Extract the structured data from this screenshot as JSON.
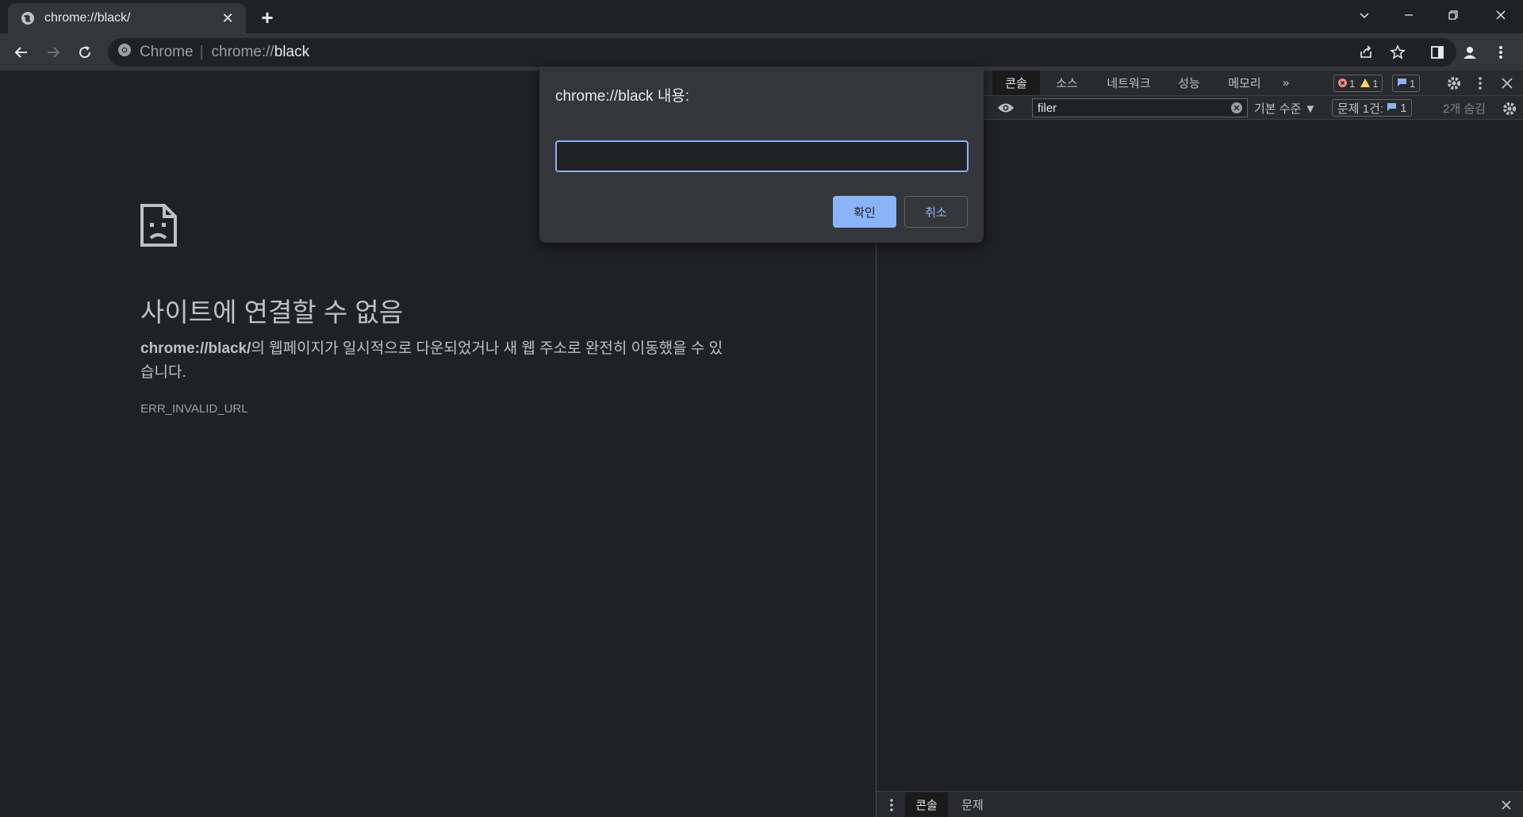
{
  "tab": {
    "title": "chrome://black/",
    "favicon": "globe-icon",
    "close": "✕",
    "new_tab": "+"
  },
  "window_controls": [
    "chevron-down-icon",
    "minimize-icon",
    "restore-icon",
    "close-icon"
  ],
  "omnibox": {
    "chip": "Chrome",
    "separator": "|",
    "scheme": "chrome://",
    "host": "black"
  },
  "error_page": {
    "icon": "sad-file-icon",
    "heading": "사이트에 연결할 수 없음",
    "desc_bold": "chrome://black/",
    "desc_rest": "의 웹페이지가 일시적으로 다운되었거나 새 웹 주소로 완전히 이동했을 수 있습니다.",
    "code": "ERR_INVALID_URL"
  },
  "devtools": {
    "tabs": [
      "콘솔",
      "소스",
      "네트워크",
      "성능",
      "메모리"
    ],
    "more": "»",
    "badges": {
      "errors": "1",
      "warnings": "1",
      "messages": "1"
    },
    "filter": {
      "value": "filer"
    },
    "level": "기본 수준 ▼",
    "issues_label": "문제 1건:",
    "issues_count": "1",
    "hidden": "2개 숨김",
    "drawer_tabs": [
      "콘솔",
      "문제"
    ]
  },
  "dialog": {
    "message": "chrome://black 내용:",
    "input_value": "",
    "ok": "확인",
    "cancel": "취소"
  },
  "colors": {
    "accent": "#8ab4f8",
    "background": "#202124",
    "toolbar": "#35363a"
  }
}
